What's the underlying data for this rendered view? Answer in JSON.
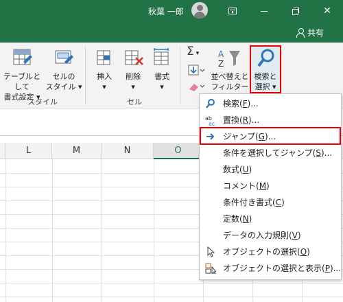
{
  "titlebar": {
    "user_name": "秋葉 一郎",
    "share_label": "共有"
  },
  "ribbon": {
    "table_style_1": "テーブルとして",
    "table_style_2": "書式設定",
    "cell_style_1": "セルの",
    "cell_style_2": "スタイル",
    "group_style": "スタイル",
    "insert": "挿入",
    "delete": "削除",
    "format": "書式",
    "group_cells": "セル",
    "sort_filter_1": "並べ替えと",
    "sort_filter_2": "フィルター",
    "find_select_1": "検索と",
    "find_select_2": "選択",
    "autosum_glyph": "Σ"
  },
  "columns": [
    "L",
    "M",
    "N",
    "O"
  ],
  "menu": {
    "items": [
      {
        "pre": "検索(",
        "key": "F",
        "post": ")...",
        "icon": "search-icon"
      },
      {
        "pre": "置換(",
        "key": "R",
        "post": ")...",
        "icon": "replace-icon"
      },
      {
        "pre": "ジャンプ(",
        "key": "G",
        "post": ")...",
        "icon": "arrow-right-icon"
      },
      {
        "pre": "条件を選択してジャンプ(",
        "key": "S",
        "post": ")...",
        "icon": ""
      },
      {
        "pre": "数式(",
        "key": "U",
        "post": ")",
        "icon": ""
      },
      {
        "pre": "コメント(",
        "key": "M",
        "post": ")",
        "icon": ""
      },
      {
        "pre": "条件付き書式(",
        "key": "C",
        "post": ")",
        "icon": ""
      },
      {
        "pre": "定数(",
        "key": "N",
        "post": ")",
        "icon": ""
      },
      {
        "pre": "データの入力規則(",
        "key": "V",
        "post": ")",
        "icon": ""
      },
      {
        "pre": "オブジェクトの選択(",
        "key": "O",
        "post": ")",
        "icon": "cursor-icon"
      },
      {
        "pre": "オブジェクトの選択と表示(",
        "key": "P",
        "post": ")...",
        "icon": "selection-pane-icon"
      }
    ]
  },
  "colors": {
    "excel_green": "#217346",
    "highlight_red": "#e00000"
  }
}
